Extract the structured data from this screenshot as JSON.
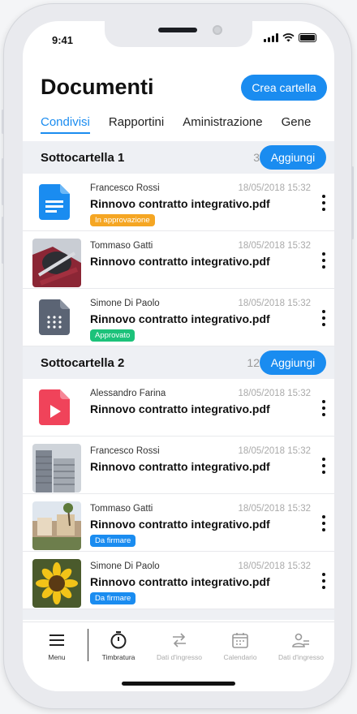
{
  "status": {
    "time": "9:41"
  },
  "header": {
    "title": "Documenti",
    "create_label": "Crea cartella"
  },
  "tabs": [
    {
      "label": "Condivisi",
      "active": true
    },
    {
      "label": "Rapportini",
      "active": false
    },
    {
      "label": "Aministrazione",
      "active": false
    },
    {
      "label": "Gene",
      "active": false
    }
  ],
  "sections": [
    {
      "title": "Sottocartella 1",
      "count": "3",
      "add_label": "Aggiungi",
      "items": [
        {
          "author": "Francesco Rossi",
          "date": "18/05/2018 15:32",
          "name": "Rinnovo contratto integrativo.pdf",
          "thumb": "doc-icon",
          "badge": "In approvazione",
          "badge_color": "#f5a623"
        },
        {
          "author": "Tommaso Gatti",
          "date": "18/05/2018 15:32",
          "name": "Rinnovo contratto integrativo.pdf",
          "thumb": "photo-helmet",
          "badge": "",
          "badge_color": ""
        },
        {
          "author": "Simone Di Paolo",
          "date": "18/05/2018 15:32",
          "name": "Rinnovo contratto integrativo.pdf",
          "thumb": "grid-icon",
          "badge": "Approvato",
          "badge_color": "#1cc27a"
        }
      ]
    },
    {
      "title": "Sottocartella 2",
      "count": "12",
      "add_label": "Aggiungi",
      "items": [
        {
          "author": "Alessandro Farina",
          "date": "18/05/2018 15:32",
          "name": "Rinnovo contratto integrativo.pdf",
          "thumb": "video-icon",
          "badge": "",
          "badge_color": ""
        },
        {
          "author": "Francesco Rossi",
          "date": "18/05/2018 15:32",
          "name": "Rinnovo contratto integrativo.pdf",
          "thumb": "photo-building",
          "badge": "",
          "badge_color": ""
        },
        {
          "author": "Tommaso Gatti",
          "date": "18/05/2018 15:32",
          "name": "Rinnovo contratto integrativo.pdf",
          "thumb": "photo-houses",
          "badge": "Da firmare",
          "badge_color": "#1a8cf0"
        },
        {
          "author": "Simone Di Paolo",
          "date": "18/05/2018 15:32",
          "name": "Rinnovo contratto integrativo.pdf",
          "thumb": "photo-sunflower",
          "badge": "Da firmare",
          "badge_color": "#1a8cf0"
        }
      ]
    }
  ],
  "tabbar": [
    {
      "label": "Menu",
      "icon": "menu-icon"
    },
    {
      "label": "Timbratura",
      "icon": "stopwatch-icon"
    },
    {
      "label": "Dati d'ingresso",
      "icon": "transfer-arrows-icon"
    },
    {
      "label": "Calendario",
      "icon": "calendar-icon"
    },
    {
      "label": "Dati d'ingresso",
      "icon": "users-icon"
    }
  ],
  "colors": {
    "accent": "#1a8cf0",
    "pending": "#f5a623",
    "approved": "#1cc27a",
    "doc": "#1a8cf0",
    "video": "#f0435a",
    "grid": "#5b6474"
  }
}
